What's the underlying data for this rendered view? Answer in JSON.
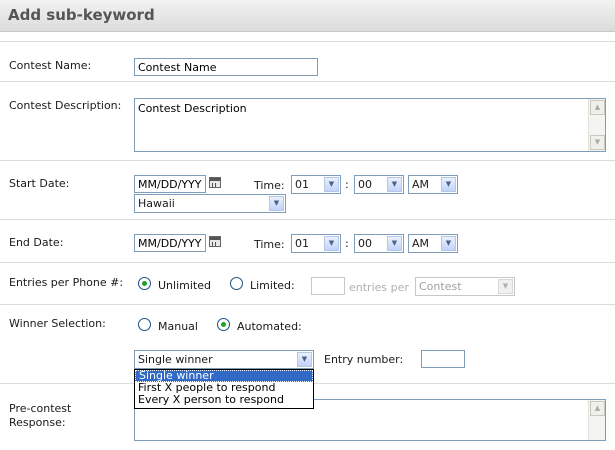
{
  "header": {
    "title": "Add sub-keyword"
  },
  "contest_name": {
    "label": "Contest Name:",
    "value": "Contest Name"
  },
  "contest_description": {
    "label": "Contest Description:",
    "value": "Contest Description"
  },
  "start_date": {
    "label": "Start Date:",
    "date_value": "MM/DD/YYY",
    "time_label": "Time:",
    "hour": "01",
    "minute": "00",
    "ampm": "AM",
    "timezone": "Hawaii"
  },
  "end_date": {
    "label": "End Date:",
    "date_value": "MM/DD/YYY",
    "time_label": "Time:",
    "hour": "01",
    "minute": "00",
    "ampm": "AM"
  },
  "entries": {
    "label": "Entries per Phone #:",
    "unlimited": "Unlimited",
    "limited": "Limited:",
    "entries_per": "entries per",
    "period": "Contest",
    "selected": "Unlimited"
  },
  "winner": {
    "label": "Winner Selection:",
    "manual": "Manual",
    "automated": "Automated:",
    "selected": "Automated",
    "mode_value": "Single winner",
    "entry_number_label": "Entry number:",
    "options": [
      "Single winner",
      "First X people to respond",
      "Every X person to respond"
    ]
  },
  "precontest": {
    "label_line1": "Pre-contest",
    "label_line2": "Response:"
  },
  "icons": {
    "calendar": "calendar-icon",
    "dropdown": "chevron-down-icon",
    "scroll_up": "scroll-up-icon",
    "scroll_down": "scroll-down-icon"
  }
}
